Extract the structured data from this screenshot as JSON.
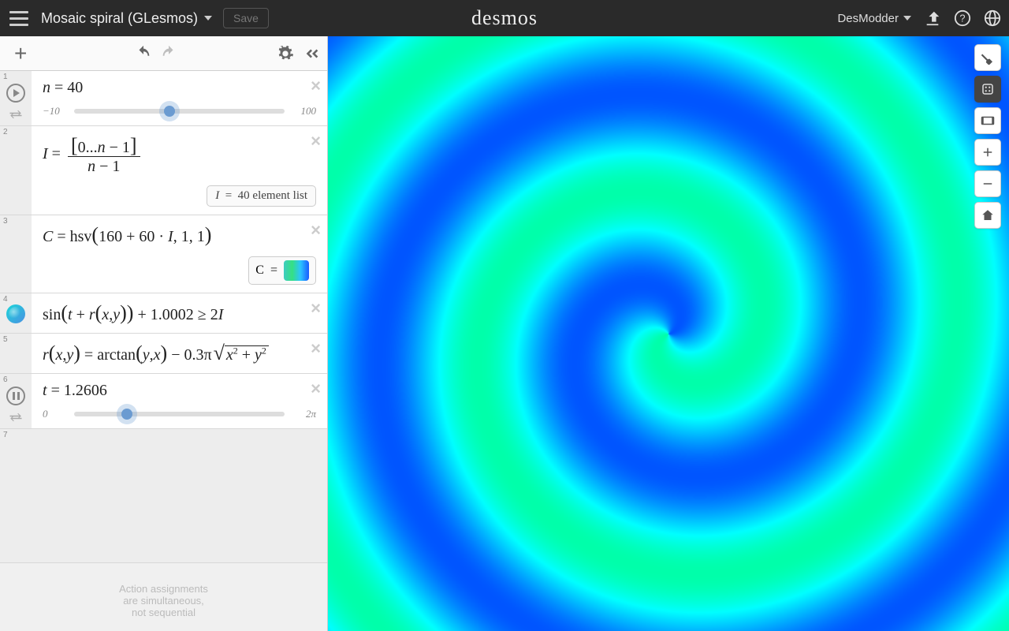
{
  "header": {
    "title": "Mosaic spiral (GLesmos)",
    "save_label": "Save",
    "logo_text": "desmos",
    "user_name": "DesModder"
  },
  "toolbar": {
    "add_icon": "+"
  },
  "expressions": [
    {
      "index": "1",
      "gutter": "play",
      "formula_html": "<span class='it'>n</span> <span class='rm'>=</span> <span class='rm'>40</span>",
      "slider": {
        "min": "−10",
        "max": "100",
        "pos": 45.5
      }
    },
    {
      "index": "2",
      "gutter": "",
      "formula_html": "<span class='it'>I</span> <span class='rm'>=</span> <span class='frac'><span class='num'><span class='rm big'>[</span><span class='rm'>0...</span><span class='it'>n</span> <span class='rm'>− 1</span><span class='rm big'>]</span></span><br><span class='den'><span class='it'>n</span> <span class='rm'>− 1</span></span></span>",
      "badge_html": "<span class='it'>I</span>&nbsp; = &nbsp;40 element list"
    },
    {
      "index": "3",
      "gutter": "",
      "formula_html": "<span class='it'>C</span> <span class='rm'>= hsv</span><span class='rm big'>(</span><span class='rm'>160 + 60 · </span><span class='it'>I</span><span class='rm'>, 1, 1</span><span class='rm big'>)</span>",
      "color_badge_label": "C  ="
    },
    {
      "index": "4",
      "gutter": "color-dot",
      "formula_html": "<span class='rm'>sin</span><span class='rm big'>(</span><span class='it'>t</span> <span class='rm'>+</span> <span class='it'>r</span><span class='rm big'>(</span><span class='it'>x</span><span class='rm'>,</span><span class='it'>y</span><span class='rm big'>)</span><span class='rm big'>)</span> <span class='rm'>+ 1.0002 ≥ 2</span><span class='it'>I</span>"
    },
    {
      "index": "5",
      "gutter": "",
      "formula_html": "<span class='it'>r</span><span class='rm big'>(</span><span class='it'>x</span><span class='rm'>,</span><span class='it'>y</span><span class='rm big'>)</span> <span class='rm'>= arctan</span><span class='rm big'>(</span><span class='it'>y</span><span class='rm'>,</span><span class='it'>x</span><span class='rm big'>)</span> <span class='rm'>− 0.3π</span><span class='sqrt-sign'><span class='rm big'>√</span><span class='vin'><span class='it'>x</span><span class='sup rm'>2</span> <span class='rm'>+</span> <span class='it'>y</span><span class='sup rm'>2</span></span></span>"
    },
    {
      "index": "6",
      "gutter": "pause",
      "formula_html": "<span class='it'>t</span> <span class='rm'>= 1.2606</span>",
      "slider": {
        "min": "0",
        "max": "2π",
        "pos": 25
      }
    },
    {
      "index": "7",
      "gutter": "",
      "empty": true
    }
  ],
  "footer": {
    "line1": "Action assignments",
    "line2": "are simultaneous,",
    "line3": "not sequential"
  },
  "spiral": {
    "t": 1.2606,
    "hue_start": 160,
    "hue_span": 60
  }
}
